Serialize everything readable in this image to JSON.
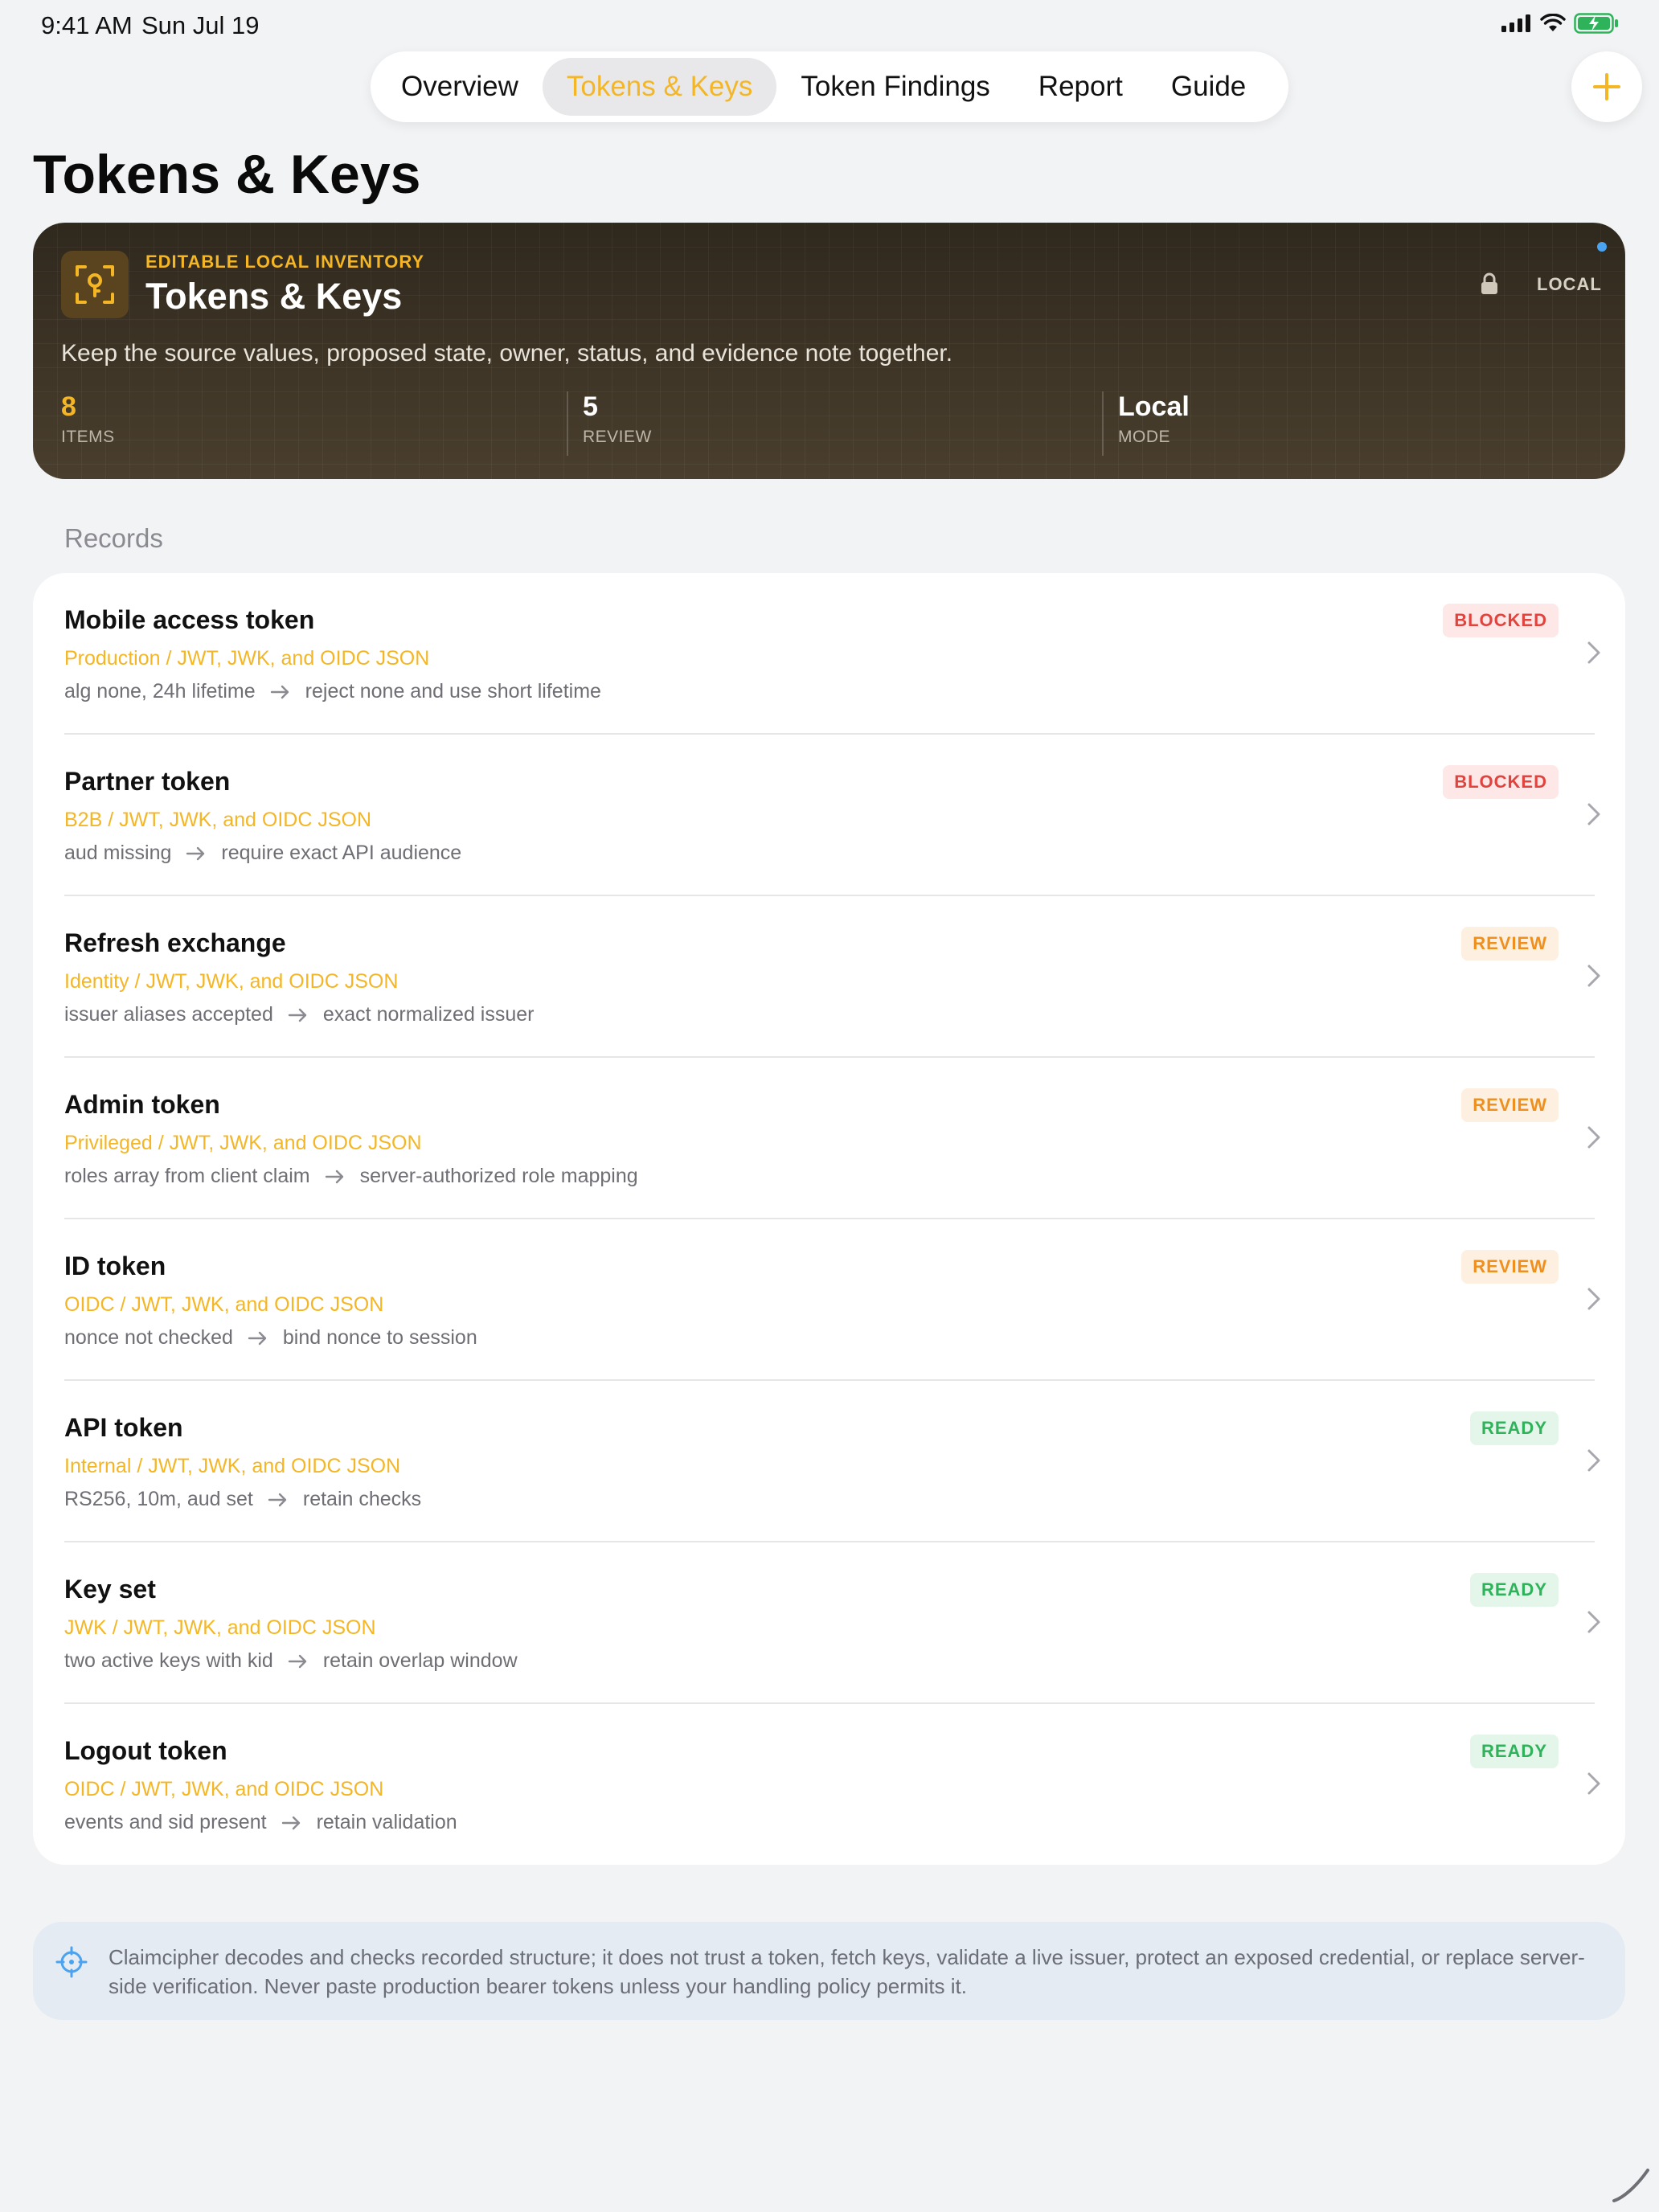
{
  "status_bar": {
    "time": "9:41 AM",
    "date": "Sun Jul 19"
  },
  "tabs": [
    {
      "label": "Overview",
      "active": false
    },
    {
      "label": "Tokens & Keys",
      "active": true
    },
    {
      "label": "Token Findings",
      "active": false
    },
    {
      "label": "Report",
      "active": false
    },
    {
      "label": "Guide",
      "active": false
    }
  ],
  "add_button_icon": "plus-icon",
  "page_title": "Tokens & Keys",
  "hero": {
    "eyebrow": "EDITABLE LOCAL INVENTORY",
    "title": "Tokens & Keys",
    "mode_badge": "LOCAL",
    "description": "Keep the source values, proposed state, owner, status, and evidence note together.",
    "stats": [
      {
        "value": "8",
        "label": "ITEMS"
      },
      {
        "value": "5",
        "label": "REVIEW"
      },
      {
        "value": "Local",
        "label": "MODE"
      }
    ],
    "accent_color": "#f4b625"
  },
  "records_label": "Records",
  "records": [
    {
      "title": "Mobile access token",
      "subtitle": "Production / JWT, JWK, and OIDC JSON",
      "from": "alg none, 24h lifetime",
      "to": "reject none and use short lifetime",
      "status": "BLOCKED",
      "kind": "blocked"
    },
    {
      "title": "Partner token",
      "subtitle": "B2B / JWT, JWK, and OIDC JSON",
      "from": "aud missing",
      "to": "require exact API audience",
      "status": "BLOCKED",
      "kind": "blocked"
    },
    {
      "title": "Refresh exchange",
      "subtitle": "Identity / JWT, JWK, and OIDC JSON",
      "from": "issuer aliases accepted",
      "to": "exact normalized issuer",
      "status": "REVIEW",
      "kind": "review"
    },
    {
      "title": "Admin token",
      "subtitle": "Privileged / JWT, JWK, and OIDC JSON",
      "from": "roles array from client claim",
      "to": "server-authorized role mapping",
      "status": "REVIEW",
      "kind": "review"
    },
    {
      "title": "ID token",
      "subtitle": "OIDC / JWT, JWK, and OIDC JSON",
      "from": "nonce not checked",
      "to": "bind nonce to session",
      "status": "REVIEW",
      "kind": "review"
    },
    {
      "title": "API token",
      "subtitle": "Internal / JWT, JWK, and OIDC JSON",
      "from": "RS256, 10m, aud set",
      "to": "retain checks",
      "status": "READY",
      "kind": "ready"
    },
    {
      "title": "Key set",
      "subtitle": "JWK / JWT, JWK, and OIDC JSON",
      "from": "two active keys with kid",
      "to": "retain overlap window",
      "status": "READY",
      "kind": "ready"
    },
    {
      "title": "Logout token",
      "subtitle": "OIDC / JWT, JWK, and OIDC JSON",
      "from": "events and sid present",
      "to": "retain validation",
      "status": "READY",
      "kind": "ready"
    }
  ],
  "footer_note": "Claimcipher decodes and checks recorded structure; it does not trust a token, fetch keys, validate a live issuer, protect an exposed credential, or replace server-side verification. Never paste production bearer tokens unless your handling policy permits it.",
  "colors": {
    "background": "#f2f3f5",
    "accent": "#f4b625",
    "blocked": "#e0443f",
    "review": "#ef8f1e",
    "ready": "#2fb35a",
    "note_background": "#e4ebf3"
  }
}
